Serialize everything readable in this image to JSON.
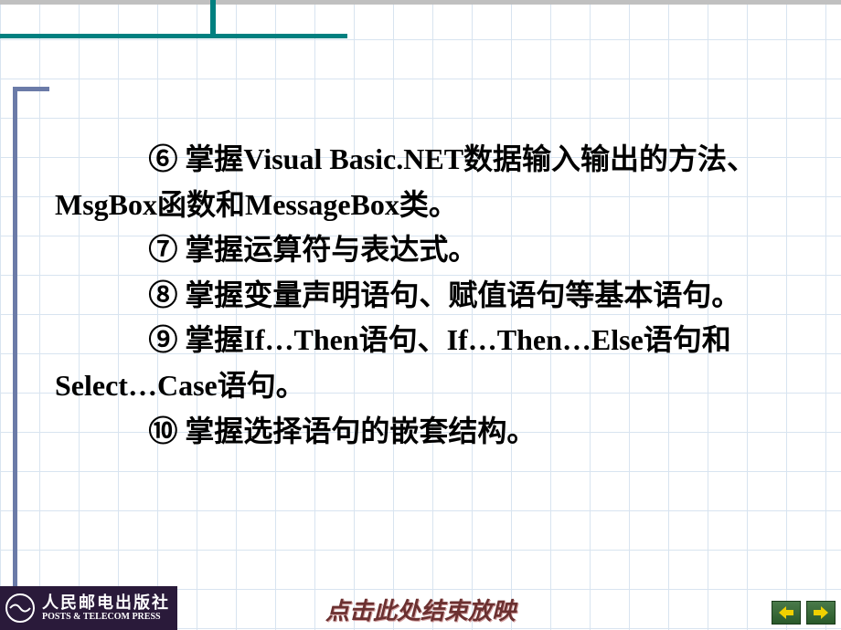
{
  "content": {
    "item6": "⑥ 掌握Visual Basic.NET数据输入输出的方法、MsgBox函数和MessageBox类。",
    "item7": "⑦ 掌握运算符与表达式。",
    "item8": "⑧ 掌握变量声明语句、赋值语句等基本语句。",
    "item9": "⑨ 掌握If…Then语句、If…Then…Else语句和Select…Case语句。",
    "item10": "⑩ 掌握选择语句的嵌套结构。"
  },
  "footer": {
    "publisher_cn": "人民邮电出版社",
    "publisher_en": "POSTS & TELECOM PRESS",
    "end_slideshow": "点击此处结束放映"
  }
}
